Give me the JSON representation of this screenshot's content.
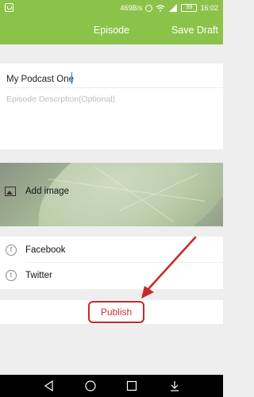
{
  "status_bar": {
    "network_speed": "469B/s",
    "battery": "99",
    "time": "16:02",
    "icons": [
      "app-icon",
      "alarm-icon",
      "wifi-icon",
      "signal-icon",
      "battery-icon"
    ]
  },
  "toolbar": {
    "title": "Episode",
    "save_label": "Save Draft"
  },
  "episode": {
    "title_value": "My Podcast One",
    "description_placeholder": "Episode Descrption(Optional)",
    "description_value": ""
  },
  "image": {
    "add_label": "Add image"
  },
  "social": {
    "items": [
      {
        "label": "Facebook",
        "icon": "facebook-icon"
      },
      {
        "label": "Twitter",
        "icon": "twitter-icon"
      }
    ]
  },
  "publish": {
    "label": "Publish",
    "highlight_color": "#c62828"
  },
  "colors": {
    "accent": "#8bc34a",
    "annotation": "#c62828"
  },
  "nav_bar": {
    "icons": [
      "back-icon",
      "home-icon",
      "recents-icon",
      "notification-pull-icon"
    ]
  }
}
